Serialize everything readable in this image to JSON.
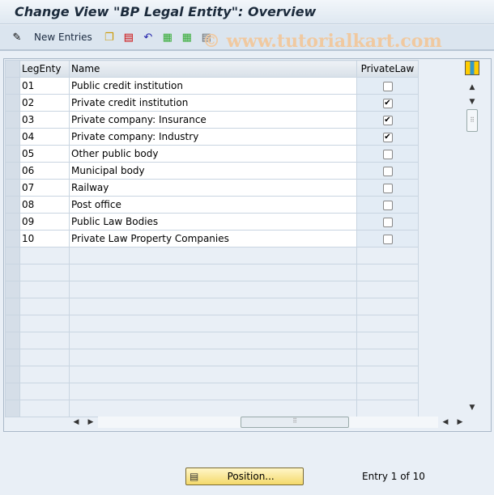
{
  "title": "Change View \"BP Legal Entity\": Overview",
  "toolbar": {
    "new_entries": "New Entries",
    "icons": [
      "edit-pencil-icon",
      "copy-icon",
      "delete-icon",
      "undo-icon",
      "select-all-icon",
      "select-block-icon",
      "deselect-all-icon"
    ]
  },
  "watermark": "© www.tutorialkart.com",
  "table": {
    "headers": [
      "LegEnty",
      "Name",
      "PrivateLaw"
    ],
    "rows": [
      {
        "code": "01",
        "name": "Public credit institution",
        "private": false
      },
      {
        "code": "02",
        "name": "Private credit institution",
        "private": true
      },
      {
        "code": "03",
        "name": "Private company: Insurance",
        "private": true
      },
      {
        "code": "04",
        "name": "Private company: Industry",
        "private": true
      },
      {
        "code": "05",
        "name": "Other public body",
        "private": false
      },
      {
        "code": "06",
        "name": "Municipal body",
        "private": false
      },
      {
        "code": "07",
        "name": "Railway",
        "private": false
      },
      {
        "code": "08",
        "name": "Post office",
        "private": false
      },
      {
        "code": "09",
        "name": "Public Law Bodies",
        "private": false
      },
      {
        "code": "10",
        "name": "Private Law Property Companies",
        "private": false
      }
    ],
    "empty_rows": 10
  },
  "footer": {
    "position_button": "Position...",
    "entry_info": "Entry 1 of 10"
  }
}
